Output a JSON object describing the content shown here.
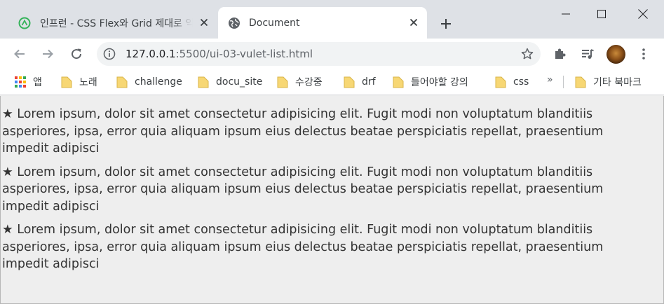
{
  "tabs": [
    {
      "title": "인프런 - CSS Flex와 Grid 제대로 익히기",
      "active": false
    },
    {
      "title": "Document",
      "active": true
    }
  ],
  "address_bar": {
    "host": "127.0.0.1",
    "path": ":5500/ui-03-vulet-list.html"
  },
  "bookmarks": {
    "apps_label": "앱",
    "items": [
      "노래",
      "challenge",
      "docu_site",
      "수강중",
      "drf",
      "들어야할 강의",
      "css"
    ],
    "more": "»",
    "other_label": "기타 북마크"
  },
  "content": {
    "bullet": "★",
    "items": [
      "Lorem ipsum, dolor sit amet consectetur adipisicing elit. Fugit modi non voluptatum blanditiis asperiores, ipsa, error quia aliquam ipsum eius delectus beatae perspiciatis repellat, praesentium impedit adipisci",
      "Lorem ipsum, dolor sit amet consectetur adipisicing elit. Fugit modi non voluptatum blanditiis asperiores, ipsa, error quia aliquam ipsum eius delectus beatae perspiciatis repellat, praesentium impedit adipisci",
      "Lorem ipsum, dolor sit amet consectetur adipisicing elit. Fugit modi non voluptatum blanditiis asperiores, ipsa, error quia aliquam ipsum eius delectus beatae perspiciatis repellat, praesentium impedit adipisci"
    ]
  },
  "colors": {
    "tabstrip": "#dee1e6",
    "page_background": "#eeeeee",
    "text": "#333333",
    "folder": "#f7d774"
  },
  "icons": [
    "inflearn-favicon",
    "globe-icon",
    "close-icon",
    "plus-icon",
    "minimize-icon",
    "maximize-icon",
    "window-close-icon",
    "back-icon",
    "forward-icon",
    "reload-icon",
    "info-icon",
    "star-icon",
    "extensions-icon",
    "media-icon",
    "more-vert-icon",
    "apps-icon",
    "folder-icon"
  ]
}
